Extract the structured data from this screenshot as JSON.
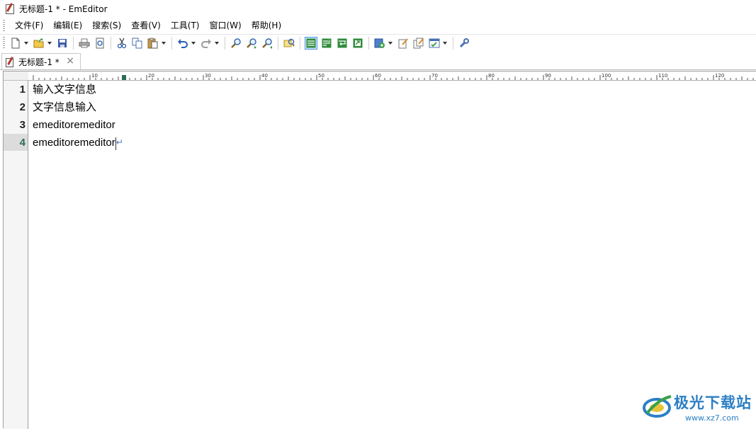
{
  "window": {
    "title": "无标题-1 * - EmEditor"
  },
  "menu": {
    "items": [
      {
        "name": "menu-file",
        "label": "文件(F)"
      },
      {
        "name": "menu-edit",
        "label": "编辑(E)"
      },
      {
        "name": "menu-search",
        "label": "搜索(S)"
      },
      {
        "name": "menu-view",
        "label": "查看(V)"
      },
      {
        "name": "menu-tools",
        "label": "工具(T)"
      },
      {
        "name": "menu-window",
        "label": "窗口(W)"
      },
      {
        "name": "menu-help",
        "label": "帮助(H)"
      }
    ]
  },
  "toolbar": {
    "buttons": [
      "new-file-icon",
      "open-file-icon",
      "save-icon",
      "print-icon",
      "print-preview-icon",
      "cut-icon",
      "copy-icon",
      "paste-icon",
      "undo-icon",
      "redo-icon",
      "find-icon",
      "find-next-icon",
      "find-previous-icon",
      "highlight-icon",
      "wrap-none-icon",
      "wrap-by-chars-icon",
      "wrap-by-window-icon",
      "wrap-by-page-icon",
      "macro-icon",
      "properties-icon",
      "configuration-icon",
      "plugin-icon",
      "tools-icon"
    ]
  },
  "tab": {
    "label": "无标题-1 *",
    "close_glyph": "×"
  },
  "ruler": {
    "labels": [
      "10",
      "20",
      "30",
      "40",
      "50",
      "60",
      "70",
      "80",
      "90",
      "100",
      "110",
      "120"
    ]
  },
  "editor": {
    "line_numbers": [
      "1",
      "2",
      "3",
      "4"
    ],
    "lines": [
      "输入文字信息",
      "文字信息输入",
      "emeditoremeditor",
      "emeditoremeditor"
    ],
    "current_line": 4,
    "eol_mark": "↵"
  },
  "watermark": {
    "title": "极光下载站",
    "url": "www.xz7.com"
  }
}
